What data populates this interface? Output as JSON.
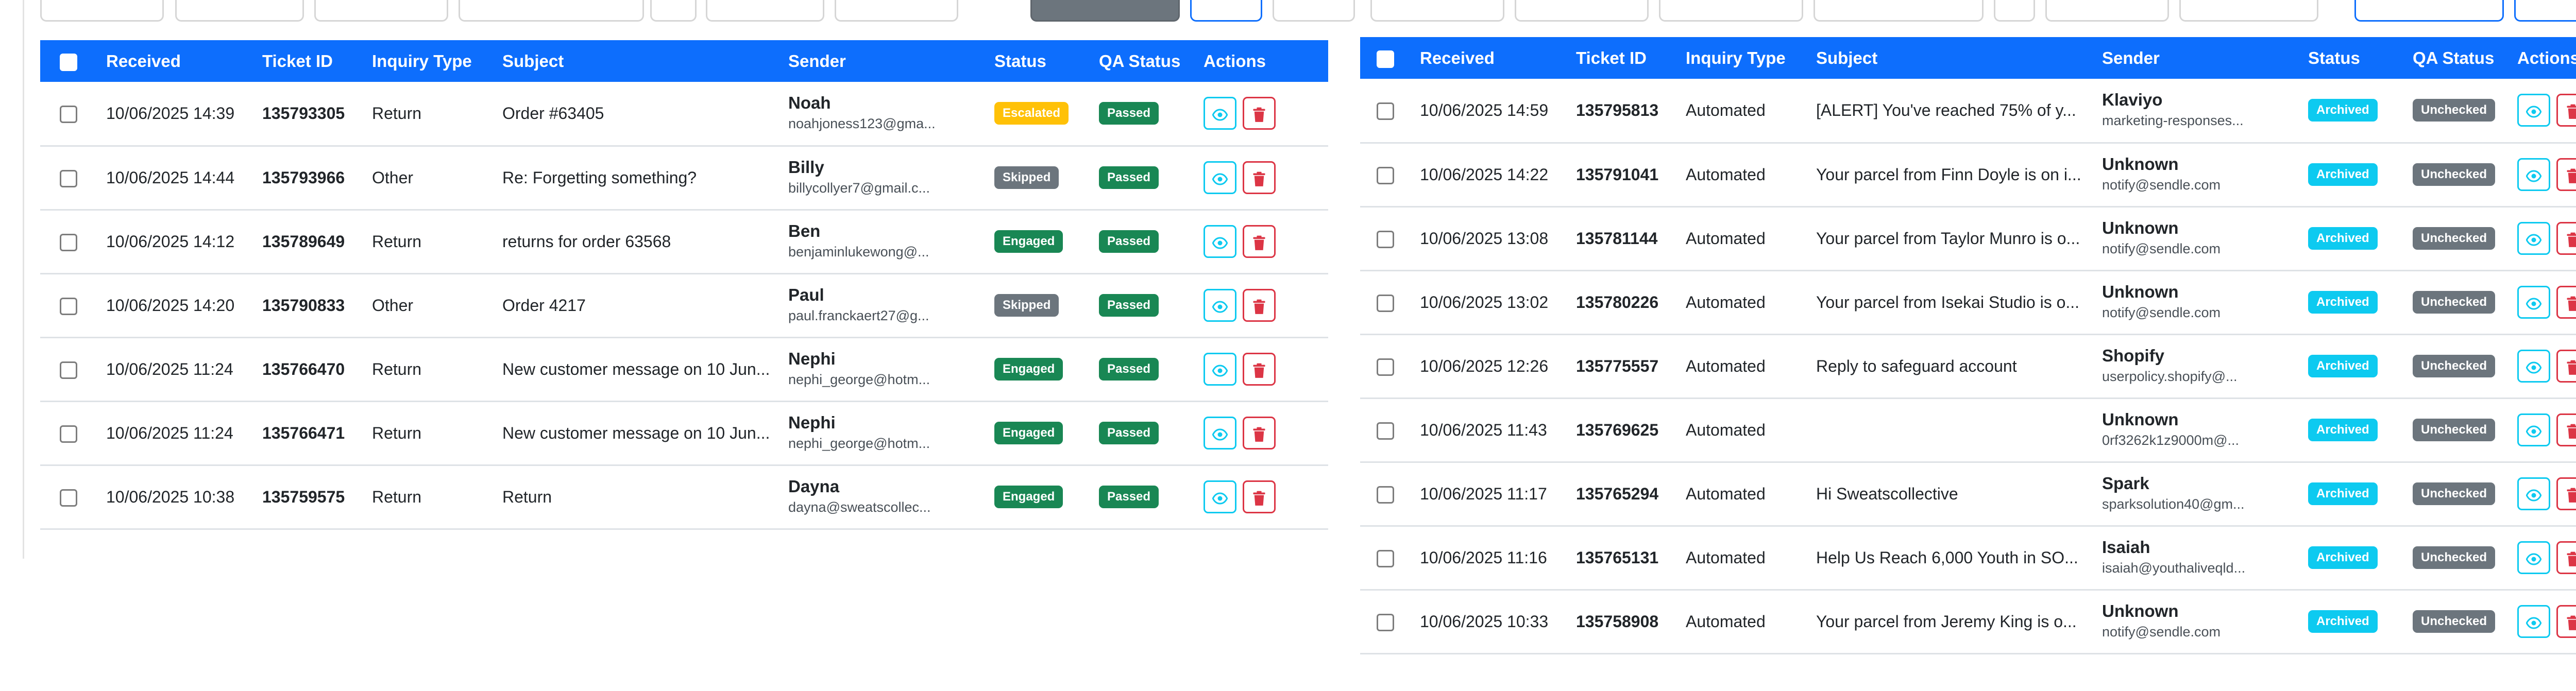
{
  "colors": {
    "header_bg": "#0d6efd",
    "escalated": "#ffc107",
    "skipped": "#6c757d",
    "engaged": "#198754",
    "passed": "#198754",
    "archived": "#0dcaf0",
    "unchecked": "#6c757d",
    "view_icon": "#0dcaf0",
    "delete_icon": "#dc3545"
  },
  "icons": {
    "view": "eye-icon",
    "delete": "trash-icon"
  },
  "left_table": {
    "columns": [
      "Received",
      "Ticket ID",
      "Inquiry Type",
      "Subject",
      "Sender",
      "Status",
      "QA Status",
      "Actions"
    ],
    "rows": [
      {
        "received": "10/06/2025 14:39",
        "ticket_id": "135793305",
        "inquiry_type": "Return",
        "subject": "Order #63405",
        "sender_name": "Noah",
        "sender_email": "noahjoness123@gma...",
        "status": "Escalated",
        "status_color": "#ffc107",
        "qa_status": "Passed",
        "qa_color": "#198754"
      },
      {
        "received": "10/06/2025 14:44",
        "ticket_id": "135793966",
        "inquiry_type": "Other",
        "subject": "Re: Forgetting something?",
        "sender_name": "Billy",
        "sender_email": "billycollyer7@gmail.c...",
        "status": "Skipped",
        "status_color": "#6c757d",
        "qa_status": "Passed",
        "qa_color": "#198754"
      },
      {
        "received": "10/06/2025 14:12",
        "ticket_id": "135789649",
        "inquiry_type": "Return",
        "subject": "returns for order 63568",
        "sender_name": "Ben",
        "sender_email": "benjaminlukewong@...",
        "status": "Engaged",
        "status_color": "#198754",
        "qa_status": "Passed",
        "qa_color": "#198754"
      },
      {
        "received": "10/06/2025 14:20",
        "ticket_id": "135790833",
        "inquiry_type": "Other",
        "subject": "Order 4217",
        "sender_name": "Paul",
        "sender_email": "paul.franckaert27@g...",
        "status": "Skipped",
        "status_color": "#6c757d",
        "qa_status": "Passed",
        "qa_color": "#198754"
      },
      {
        "received": "10/06/2025 11:24",
        "ticket_id": "135766470",
        "inquiry_type": "Return",
        "subject": "New customer message on 10 Jun...",
        "sender_name": "Nephi",
        "sender_email": "nephi_george@hotm...",
        "status": "Engaged",
        "status_color": "#198754",
        "qa_status": "Passed",
        "qa_color": "#198754"
      },
      {
        "received": "10/06/2025 11:24",
        "ticket_id": "135766471",
        "inquiry_type": "Return",
        "subject": "New customer message on 10 Jun...",
        "sender_name": "Nephi",
        "sender_email": "nephi_george@hotm...",
        "status": "Engaged",
        "status_color": "#198754",
        "qa_status": "Passed",
        "qa_color": "#198754"
      },
      {
        "received": "10/06/2025 10:38",
        "ticket_id": "135759575",
        "inquiry_type": "Return",
        "subject": "Return",
        "sender_name": "Dayna",
        "sender_email": "dayna@sweatscollec...",
        "status": "Engaged",
        "status_color": "#198754",
        "qa_status": "Passed",
        "qa_color": "#198754"
      }
    ]
  },
  "right_table": {
    "columns": [
      "Received",
      "Ticket ID",
      "Inquiry Type",
      "Subject",
      "Sender",
      "Status",
      "QA Status",
      "Actions"
    ],
    "rows": [
      {
        "received": "10/06/2025 14:59",
        "ticket_id": "135795813",
        "inquiry_type": "Automated",
        "subject": "[ALERT] You've reached 75% of y...",
        "sender_name": "Klaviyo",
        "sender_email": "marketing-responses...",
        "status": "Archived",
        "status_color": "#0dcaf0",
        "qa_status": "Unchecked",
        "qa_color": "#6c757d"
      },
      {
        "received": "10/06/2025 14:22",
        "ticket_id": "135791041",
        "inquiry_type": "Automated",
        "subject": "Your parcel from Finn Doyle is on i...",
        "sender_name": "Unknown",
        "sender_email": "notify@sendle.com",
        "status": "Archived",
        "status_color": "#0dcaf0",
        "qa_status": "Unchecked",
        "qa_color": "#6c757d"
      },
      {
        "received": "10/06/2025 13:08",
        "ticket_id": "135781144",
        "inquiry_type": "Automated",
        "subject": "Your parcel from Taylor Munro is o...",
        "sender_name": "Unknown",
        "sender_email": "notify@sendle.com",
        "status": "Archived",
        "status_color": "#0dcaf0",
        "qa_status": "Unchecked",
        "qa_color": "#6c757d"
      },
      {
        "received": "10/06/2025 13:02",
        "ticket_id": "135780226",
        "inquiry_type": "Automated",
        "subject": "Your parcel from Isekai Studio is o...",
        "sender_name": "Unknown",
        "sender_email": "notify@sendle.com",
        "status": "Archived",
        "status_color": "#0dcaf0",
        "qa_status": "Unchecked",
        "qa_color": "#6c757d"
      },
      {
        "received": "10/06/2025 12:26",
        "ticket_id": "135775557",
        "inquiry_type": "Automated",
        "subject": "Reply to safeguard account",
        "sender_name": "Shopify",
        "sender_email": "userpolicy.shopify@...",
        "status": "Archived",
        "status_color": "#0dcaf0",
        "qa_status": "Unchecked",
        "qa_color": "#6c757d"
      },
      {
        "received": "10/06/2025 11:43",
        "ticket_id": "135769625",
        "inquiry_type": "Automated",
        "subject": "",
        "sender_name": "Unknown",
        "sender_email": "0rf3262k1z9000m@...",
        "status": "Archived",
        "status_color": "#0dcaf0",
        "qa_status": "Unchecked",
        "qa_color": "#6c757d"
      },
      {
        "received": "10/06/2025 11:17",
        "ticket_id": "135765294",
        "inquiry_type": "Automated",
        "subject": "Hi Sweatscollective",
        "sender_name": "Spark",
        "sender_email": "sparksolution40@gm...",
        "status": "Archived",
        "status_color": "#0dcaf0",
        "qa_status": "Unchecked",
        "qa_color": "#6c757d"
      },
      {
        "received": "10/06/2025 11:16",
        "ticket_id": "135765131",
        "inquiry_type": "Automated",
        "subject": "Help Us Reach 6,000 Youth in SO...",
        "sender_name": "Isaiah",
        "sender_email": "isaiah@youthaliveqld...",
        "status": "Archived",
        "status_color": "#0dcaf0",
        "qa_status": "Unchecked",
        "qa_color": "#6c757d"
      },
      {
        "received": "10/06/2025 10:33",
        "ticket_id": "135758908",
        "inquiry_type": "Automated",
        "subject": "Your parcel from Jeremy King is o...",
        "sender_name": "Unknown",
        "sender_email": "notify@sendle.com",
        "status": "Archived",
        "status_color": "#0dcaf0",
        "qa_status": "Unchecked",
        "qa_color": "#6c757d"
      }
    ]
  }
}
